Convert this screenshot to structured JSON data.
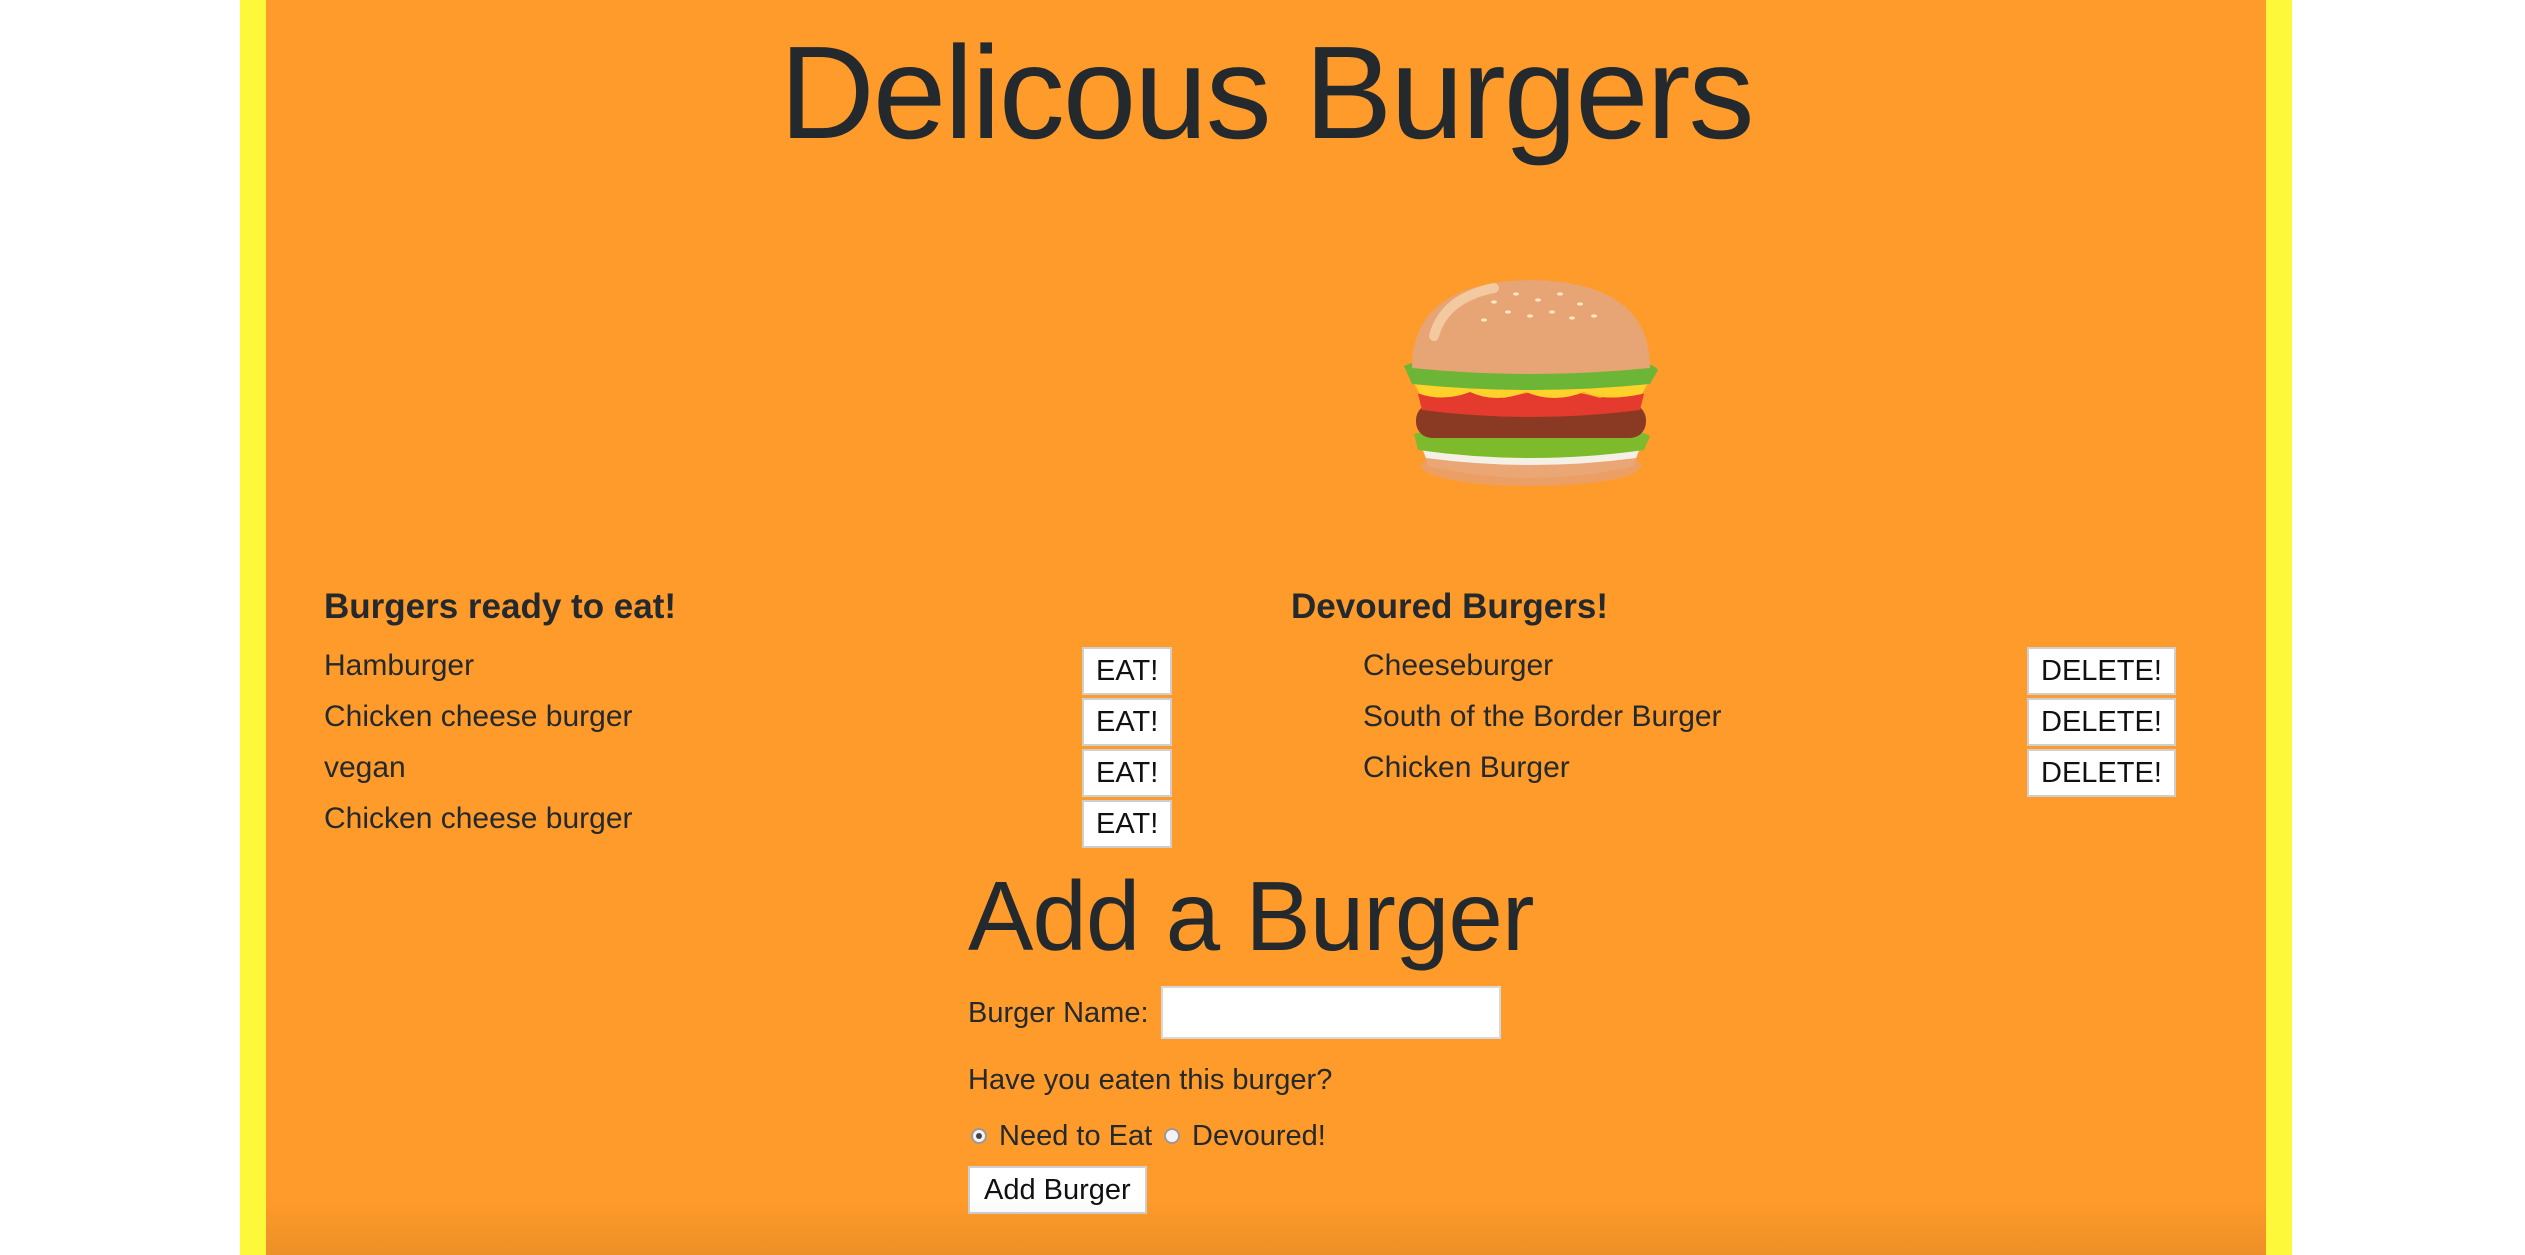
{
  "page": {
    "title": "Delicous Burgers"
  },
  "colors": {
    "background": "#ff9b2a",
    "border": "#fdf93a",
    "text": "#24292e"
  },
  "burger_image": {
    "icon": "hamburger-icon"
  },
  "ready": {
    "heading": "Burgers ready to eat!",
    "items": [
      {
        "name": "Hamburger",
        "button": "EAT!"
      },
      {
        "name": "Chicken cheese burger",
        "button": "EAT!"
      },
      {
        "name": "vegan",
        "button": "EAT!"
      },
      {
        "name": "Chicken cheese burger",
        "button": "EAT!"
      }
    ]
  },
  "devoured": {
    "heading": "Devoured Burgers!",
    "items": [
      {
        "name": "Cheeseburger",
        "button": "DELETE!"
      },
      {
        "name": "South of the Border Burger",
        "button": "DELETE!"
      },
      {
        "name": "Chicken Burger",
        "button": "DELETE!"
      }
    ]
  },
  "form": {
    "title": "Add a Burger",
    "name_label": "Burger Name:",
    "name_value": "",
    "question": "Have you eaten this burger?",
    "options": [
      {
        "label": "Need to Eat",
        "checked": true
      },
      {
        "label": "Devoured!",
        "checked": false
      }
    ],
    "submit": "Add Burger"
  }
}
